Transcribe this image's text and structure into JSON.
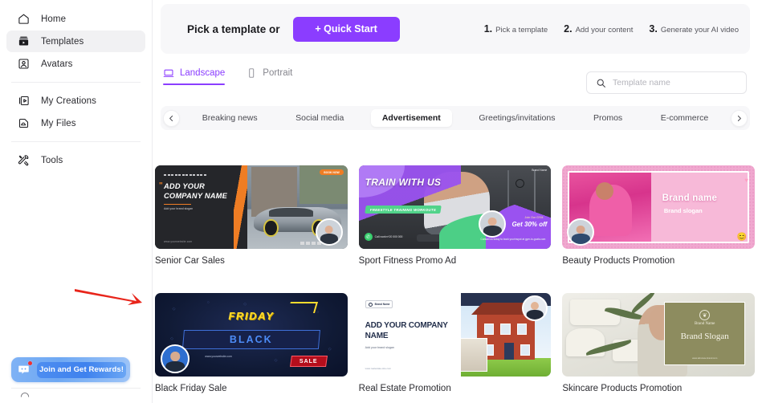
{
  "sidebar": {
    "groups": [
      {
        "items": [
          {
            "label": "Home",
            "icon": "home-icon",
            "active": false
          },
          {
            "label": "Templates",
            "icon": "templates-icon",
            "active": true
          },
          {
            "label": "Avatars",
            "icon": "avatars-icon",
            "active": false
          }
        ]
      },
      {
        "items": [
          {
            "label": "My Creations",
            "icon": "my-creations-icon",
            "active": false
          },
          {
            "label": "My Files",
            "icon": "my-files-icon",
            "active": false
          }
        ]
      },
      {
        "items": [
          {
            "label": "Tools",
            "icon": "tools-icon",
            "active": false
          }
        ]
      }
    ],
    "rewards": {
      "label": "Join and Get Rewards!",
      "icon": "discord-icon"
    }
  },
  "banner": {
    "title": "Pick a template or",
    "quick_start_label": "+ Quick Start",
    "quick_start_color": "#8b3dff",
    "steps": [
      {
        "num": "1.",
        "text": "Pick a template"
      },
      {
        "num": "2.",
        "text": "Add your content"
      },
      {
        "num": "3.",
        "text": "Generate your AI video"
      }
    ]
  },
  "view_tabs": [
    {
      "label": "Landscape",
      "icon": "landscape-icon",
      "active": true
    },
    {
      "label": "Portrait",
      "icon": "portrait-icon",
      "active": false
    }
  ],
  "search": {
    "placeholder": "Template name",
    "value": "",
    "icon": "search-icon"
  },
  "categories": {
    "prev_icon": "chevron-left-icon",
    "next_icon": "chevron-right-icon",
    "items": [
      {
        "label": "Breaking news",
        "active": false
      },
      {
        "label": "Social media",
        "active": false
      },
      {
        "label": "Advertisement",
        "active": true
      },
      {
        "label": "Greetings/invitations",
        "active": false
      },
      {
        "label": "Promos",
        "active": false
      },
      {
        "label": "E-commerce",
        "active": false
      }
    ]
  },
  "templates": [
    {
      "title": "Senior Car Sales",
      "art": "car",
      "text": {
        "company": "ADD YOUR COMPANY NAME",
        "slogan": "Add your brand slogan",
        "url": "www.yourwebsite.com",
        "badge": "BOOK NOW"
      }
    },
    {
      "title": "Sport Fitness Promo Ad",
      "art": "fitness",
      "text": {
        "headline": "TRAIN WITH US",
        "sub": "FREESTYLE TRAINING WORKOUTS",
        "offer": "Get 30% off",
        "join": "Join Our GYM",
        "cta": "Contact us today to book your\\nspot at gym-to-goals.com",
        "phone": "Call now\\n+20 000 000",
        "logo": "Brand Name"
      }
    },
    {
      "title": "Beauty Products Promotion",
      "art": "beauty",
      "text": {
        "brand": "Brand name",
        "slogan": "Brand slogan"
      }
    },
    {
      "title": "Black Friday Sale",
      "art": "blackfriday",
      "text": {
        "friday": "FRIDAY",
        "black": "BLACK",
        "sale": "SALE",
        "url": "www.yourwebsite.com"
      }
    },
    {
      "title": "Real Estate Promotion",
      "art": "realestate",
      "text": {
        "logo": "Brand Name",
        "headline": "ADD YOUR COMPANY NAME",
        "slogan": "Add your brand slogan",
        "url": "www.realestate-site.com"
      }
    },
    {
      "title": "Skincare Products Promotion",
      "art": "skincare",
      "text": {
        "brand": "Brand Name",
        "slogan": "Brand Slogan",
        "url": "www.skincare-brand.com"
      }
    }
  ]
}
